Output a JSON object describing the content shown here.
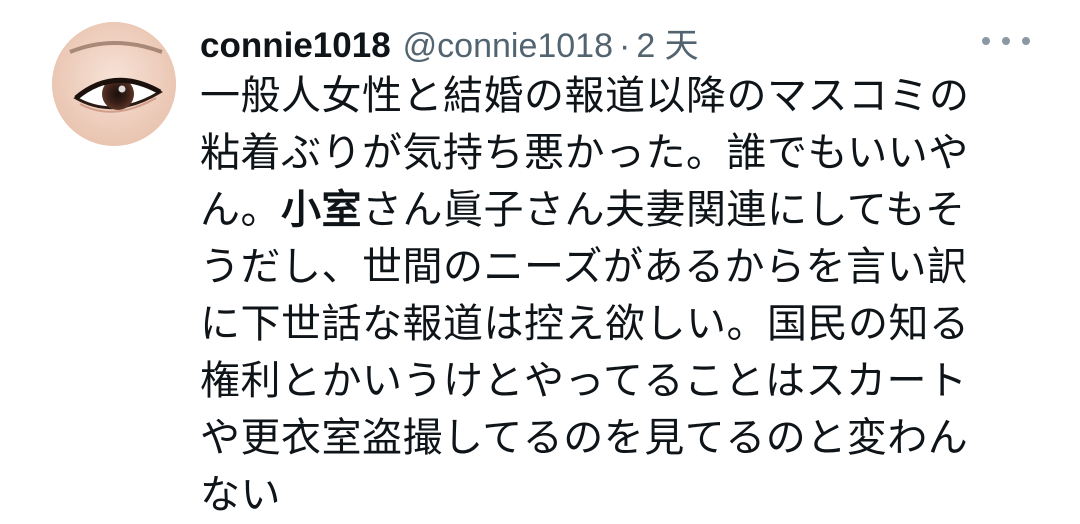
{
  "tweet": {
    "display_name": "connie1018",
    "handle": "@connie1018",
    "separator": "·",
    "time": "2 天",
    "avatar_icon": "eye-closeup-avatar",
    "more_icon": "more-dots-icon",
    "lines": {
      "l1": "一般人女性と結婚の報道以降のマスコミの",
      "l2": "粘着ぶりが気持ち悪かった。誰でもいいや",
      "l3_pre": "ん。",
      "l3_bold": "小室",
      "l3_post": "さん眞子さん夫妻関連にしてもそ",
      "l4": "うだし、世間のニーズがあるからを言い訳",
      "l5": "に下世話な報道は控え欲しい。国民の知る",
      "l6": "権利とかいうけとやってることはスカート",
      "l7": "や更衣室盗撮してるのを見てるのと変わん",
      "l8": "ない"
    }
  },
  "colors": {
    "text": "#0f1419",
    "secondary": "#536471",
    "background": "#ffffff"
  }
}
